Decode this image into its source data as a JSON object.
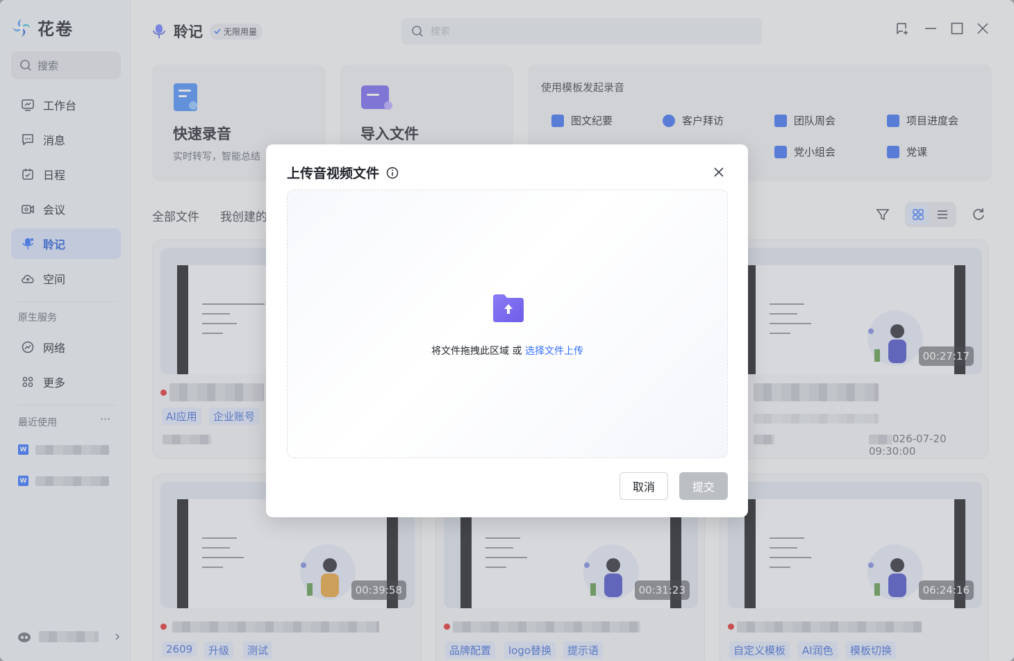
{
  "app": {
    "name": "花卷"
  },
  "sidebar": {
    "search_label": "搜索",
    "items": [
      {
        "label": "工作台",
        "icon": "workbench-icon"
      },
      {
        "label": "消息",
        "icon": "message-icon"
      },
      {
        "label": "日程",
        "icon": "calendar-icon"
      },
      {
        "label": "会议",
        "icon": "meeting-icon"
      },
      {
        "label": "聆记",
        "icon": "mic-icon",
        "active": true
      },
      {
        "label": "空间",
        "icon": "cloud-icon"
      }
    ],
    "native_services_title": "原生服务",
    "services": [
      {
        "label": "网络",
        "icon": "network-icon"
      },
      {
        "label": "更多",
        "icon": "more-grid-icon"
      }
    ],
    "recent_title": "最近使用",
    "recent_more": "···"
  },
  "header": {
    "title": "聆记",
    "badge": "无限用量",
    "search_placeholder": "搜索"
  },
  "quick_cards": [
    {
      "title": "快速录音",
      "subtitle": "实时转写，智能总结"
    },
    {
      "title": "导入文件",
      "subtitle": ""
    }
  ],
  "templates": {
    "title": "使用模板发起录音",
    "items": [
      "图文纪要",
      "客户拜访",
      "团队周会",
      "项目进度会",
      "党小组会",
      "党课"
    ]
  },
  "tabs": [
    "全部文件",
    "我创建的"
  ],
  "files": [
    {
      "tags": [
        "AI应用",
        "企业账号"
      ]
    },
    {
      "duration": "00:27:17",
      "date": "2026-07-20 09:30:00",
      "date_shown": "026-07-20 09:30:00"
    },
    {
      "duration": "00:39:58",
      "tags": [
        "2609",
        "升级",
        "测试"
      ]
    },
    {
      "duration": "00:31:23",
      "tags": [
        "品牌配置",
        "logo替换",
        "提示语"
      ]
    },
    {
      "duration": "06:24:16",
      "tags": [
        "自定义模板",
        "AI润色",
        "模板切换"
      ]
    }
  ],
  "modal": {
    "title": "上传音视频文件",
    "drop_text": "将文件拖拽此区域 或 ",
    "drop_link": "选择文件上传",
    "cancel": "取消",
    "submit": "提交"
  },
  "colors": {
    "accent": "#3370ff",
    "record_dot": "#e02e2e",
    "folder": "#7c6cf0"
  }
}
